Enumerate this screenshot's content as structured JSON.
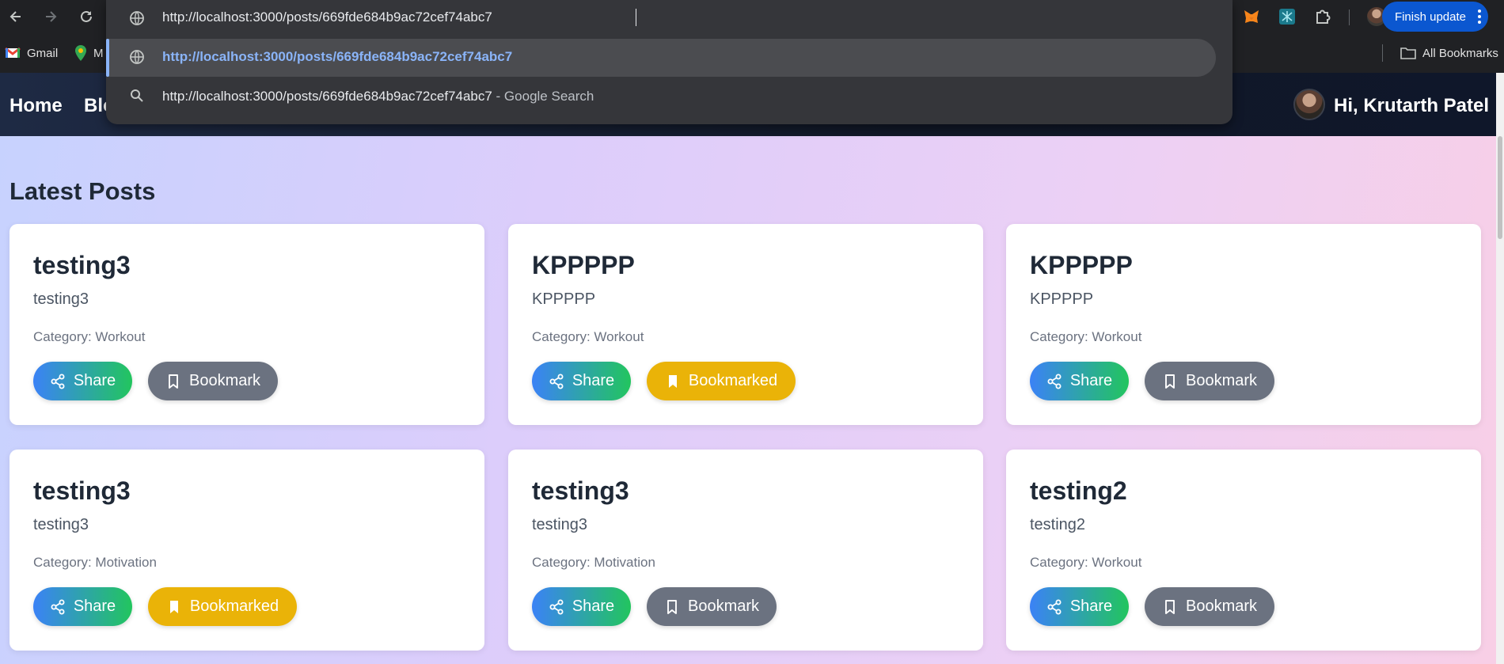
{
  "browser": {
    "address_text": "http://localhost:3000/posts/669fde684b9ac72cef74abc7",
    "suggestion_url": "http://localhost:3000/posts/669fde684b9ac72cef74abc7",
    "search_query": "http://localhost:3000/posts/669fde684b9ac72cef74abc7",
    "search_suffix": " - Google Search",
    "finish_update": "Finish update",
    "bookmarks": [
      {
        "label": "Gmail"
      },
      {
        "label": "M"
      }
    ],
    "all_bookmarks": "All Bookmarks"
  },
  "site": {
    "nav": {
      "home": "Home",
      "blog": "Blo"
    },
    "greeting": "Hi, Krutarth Patel",
    "page_title": "Latest Posts",
    "posts": [
      {
        "title": "testing3",
        "body": "testing3",
        "category": "Category: Workout",
        "share": "Share",
        "bookmark": "Bookmark",
        "bookmarked": false
      },
      {
        "title": "KPPPPP",
        "body": "KPPPPP",
        "category": "Category: Workout",
        "share": "Share",
        "bookmark": "Bookmarked",
        "bookmarked": true
      },
      {
        "title": "KPPPPP",
        "body": "KPPPPP",
        "category": "Category: Workout",
        "share": "Share",
        "bookmark": "Bookmark",
        "bookmarked": false
      },
      {
        "title": "testing3",
        "body": "testing3",
        "category": "Category: Motivation",
        "share": "Share",
        "bookmark": "Bookmarked",
        "bookmarked": true
      },
      {
        "title": "testing3",
        "body": "testing3",
        "category": "Category: Motivation",
        "share": "Share",
        "bookmark": "Bookmark",
        "bookmarked": false
      },
      {
        "title": "testing2",
        "body": "testing2",
        "category": "Category: Workout",
        "share": "Share",
        "bookmark": "Bookmark",
        "bookmarked": false
      }
    ]
  },
  "colors": {
    "share_gradient_start": "#3b82f6",
    "share_gradient_end": "#22c55e",
    "bookmark": "#6b7280",
    "bookmarked": "#eab308",
    "nav_bg": "#111827"
  }
}
